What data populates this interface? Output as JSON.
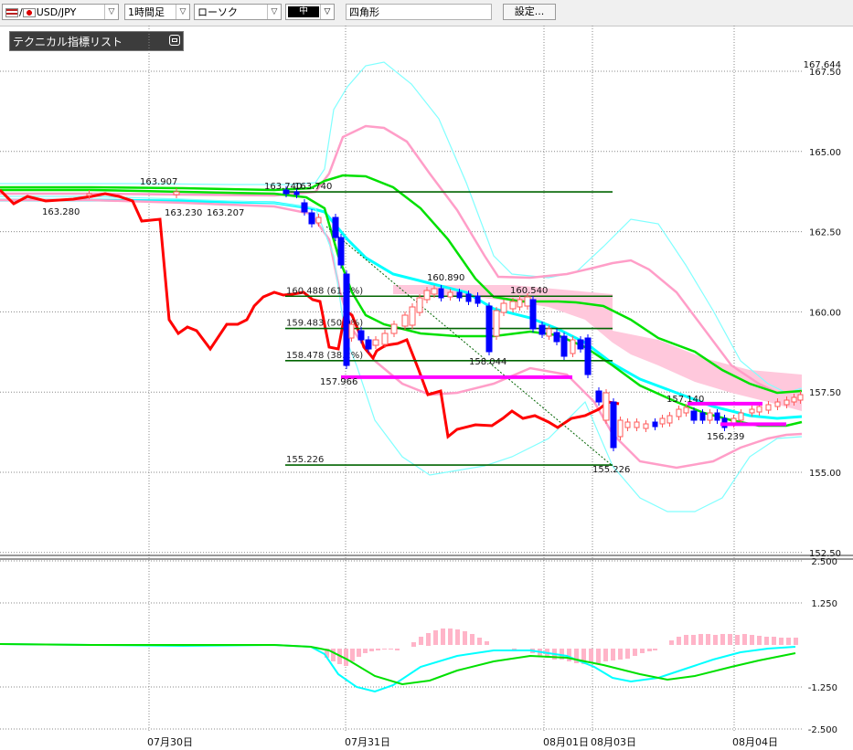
{
  "toolbar": {
    "symbol": "USD/JPY",
    "timeframe": "1時間足",
    "chart_type": "ローソク",
    "line_width": "中",
    "drawing_tool": "四角形",
    "settings_button": "設定..."
  },
  "indicator_panel": {
    "title": "テクニカル指標リスト"
  },
  "chart_data": {
    "type": "line",
    "price_axis": {
      "ticks": [
        "167.50",
        "165.00",
        "162.50",
        "160.00",
        "157.50",
        "155.00",
        "152.50"
      ],
      "current_price_label": "167.644"
    },
    "osc_axis": {
      "ticks": [
        "2.500",
        "1.250",
        "-1.250",
        "-2.500"
      ]
    },
    "x_axis": {
      "ticks": [
        "07月30日",
        "07月31日",
        "08月01日",
        "08月03日",
        "08月04日"
      ]
    },
    "price_labels": [
      "163.907",
      "163.280",
      "163.230",
      "163.207",
      "163.740",
      "163.740",
      "160.890",
      "160.540",
      "157.966",
      "158.044",
      "157.140",
      "156.239",
      "155.226"
    ],
    "fibonacci": [
      {
        "price": 160.488,
        "label": "160.488 (61.8%)"
      },
      {
        "price": 159.483,
        "label": "159.483 (50.0%)"
      },
      {
        "price": 158.478,
        "label": "158.478 (38.2%)"
      },
      {
        "price": 155.226,
        "label": "155.226"
      }
    ],
    "levels": [
      163.74
    ],
    "colors": {
      "candle_up": "#ff5a5a",
      "candle_down": "#0000ff",
      "ichimoku": "#ff0000",
      "ma_fast": "#00ffff",
      "ma_slow": "#00e000",
      "bollinger_inner": "#ff9ec8",
      "bollinger_outer": "#80ffff",
      "cloud": "#ffc8dc",
      "support_line": "#ff00ff",
      "fibonacci": "#006400"
    }
  }
}
